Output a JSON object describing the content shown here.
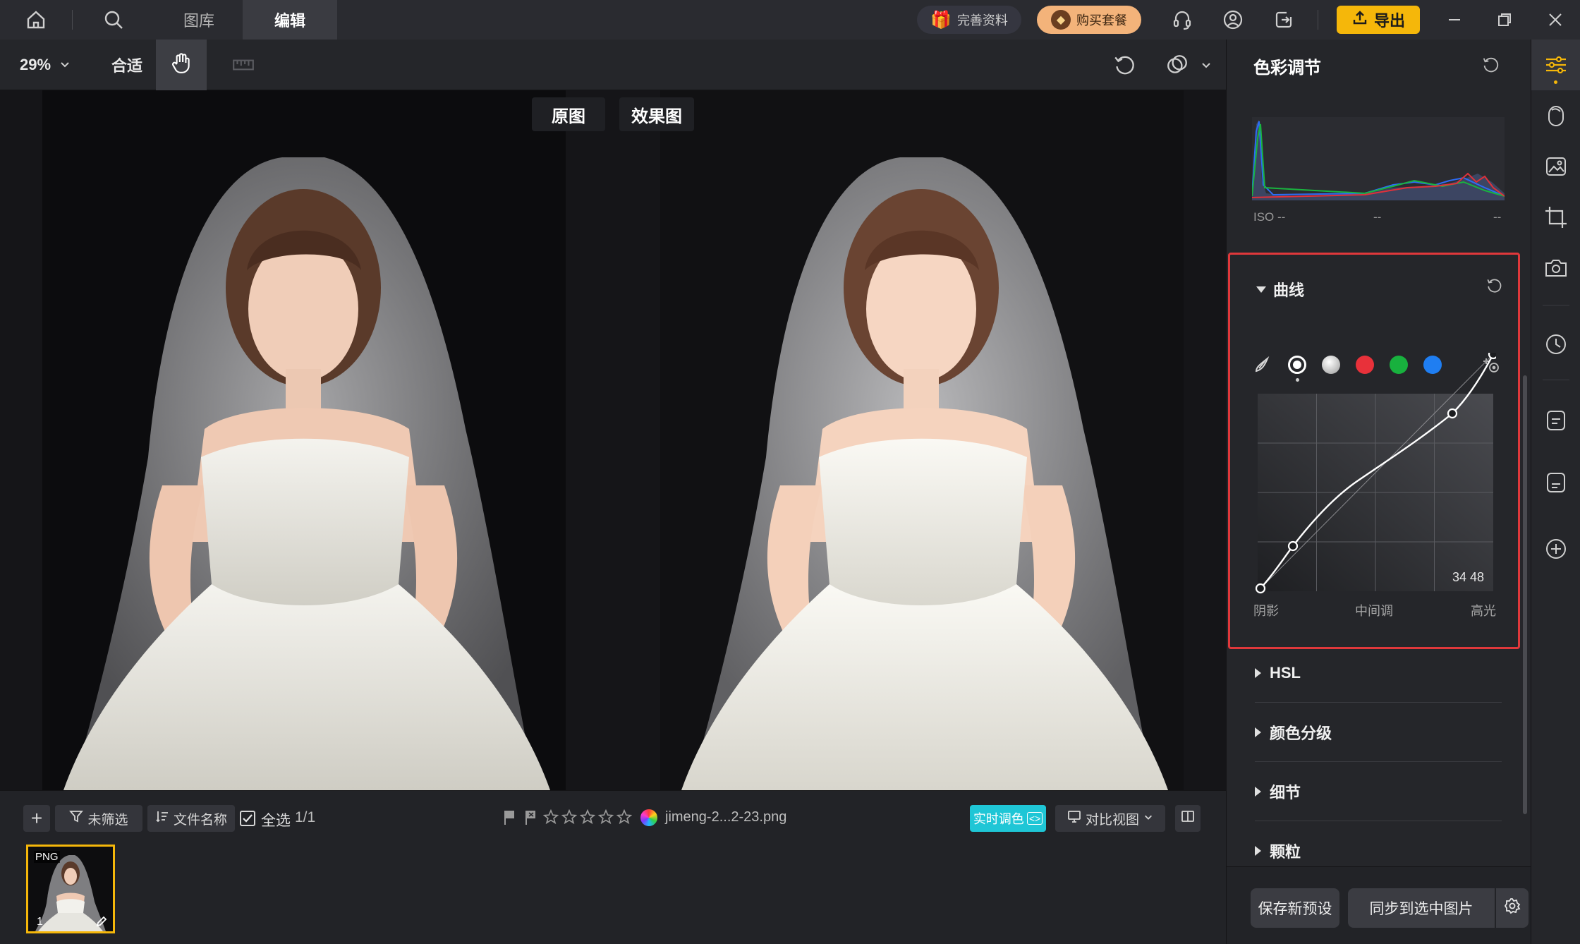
{
  "topbar": {
    "tabs": [
      {
        "label": "图库",
        "active": false
      },
      {
        "label": "编辑",
        "active": true
      }
    ],
    "complete_info_label": "完善资料",
    "buy_plan_label": "购买套餐",
    "export_label": "导出",
    "export_color": "#f5b70a"
  },
  "toolbar": {
    "zoom": "29%",
    "fit_label": "合适"
  },
  "canvas": {
    "original_label": "原图",
    "effect_label": "效果图"
  },
  "bottombar": {
    "filter_label": "未筛选",
    "sort_label": "文件名称",
    "select_all_label": "全选",
    "count": "1/1",
    "rating_stars": 5,
    "filename": "jimeng-2...2-23.png",
    "realtime_label": "实时调色",
    "realtime_color": "#1fc6d6",
    "compare_view_label": "对比视图",
    "thumbnail": {
      "format": "PNG",
      "index": "1"
    }
  },
  "panel": {
    "title": "色彩调节",
    "histogram": {
      "iso": "ISO --",
      "mid": "--",
      "right": "--"
    },
    "curves": {
      "title": "曲线",
      "channels": [
        "rgb",
        "white",
        "gray",
        "red",
        "green",
        "blue"
      ],
      "channel_colors": {
        "red": "#e8313a",
        "green": "#18b13e",
        "blue": "#1f7ef2"
      },
      "readout": "34 48",
      "shadows_label": "阴影",
      "midtones_label": "中间调",
      "highlights_label": "高光",
      "highlight_border_color": "#e0383b"
    },
    "sections": [
      {
        "label": "HSL"
      },
      {
        "label": "颜色分级"
      },
      {
        "label": "细节"
      },
      {
        "label": "颗粒"
      }
    ],
    "save_preset_label": "保存新预设",
    "sync_label": "同步到选中图片"
  }
}
